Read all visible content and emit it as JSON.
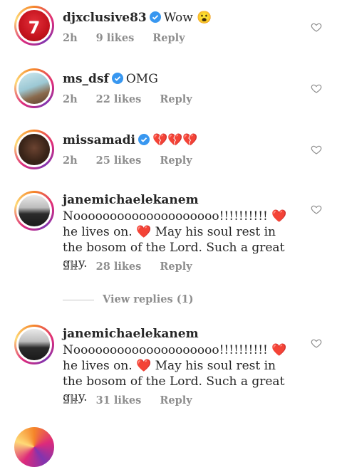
{
  "comments": [
    {
      "username": "djxclusive83",
      "text": "Wow 😮",
      "time": "2h",
      "likes": "9 likes",
      "reply": "Reply"
    },
    {
      "username": "ms_dsf",
      "text": "OMG",
      "time": "2h",
      "likes": "22 likes",
      "reply": "Reply"
    },
    {
      "username": "missamadi",
      "text": "💔💔💔",
      "time": "2h",
      "likes": "25 likes",
      "reply": "Reply"
    },
    {
      "username": "janemichaelekanem",
      "text": "Noooooooooooooooooooo!!!!!!!!!! ❤️he lives on. ❤️ May his soul rest in the bosom of the Lord. Such a great guy.",
      "time": "2h",
      "likes": "28 likes",
      "reply": "Reply"
    },
    {
      "username": "janemichaelekanem",
      "text": "Noooooooooooooooooooo!!!!!!!!!! ❤️he lives on. ❤️ May his soul rest in the bosom of the Lord. Such a great guy.",
      "time": "2h",
      "likes": "31 likes",
      "reply": "Reply"
    }
  ],
  "view_replies": "View replies (1)",
  "icons": {
    "verified": "verified-badge-icon",
    "like": "heart-outline-icon"
  },
  "colors": {
    "verified": "#3897f0",
    "meta": "#8e8e8e",
    "heart_emoji": "#d7263d"
  }
}
